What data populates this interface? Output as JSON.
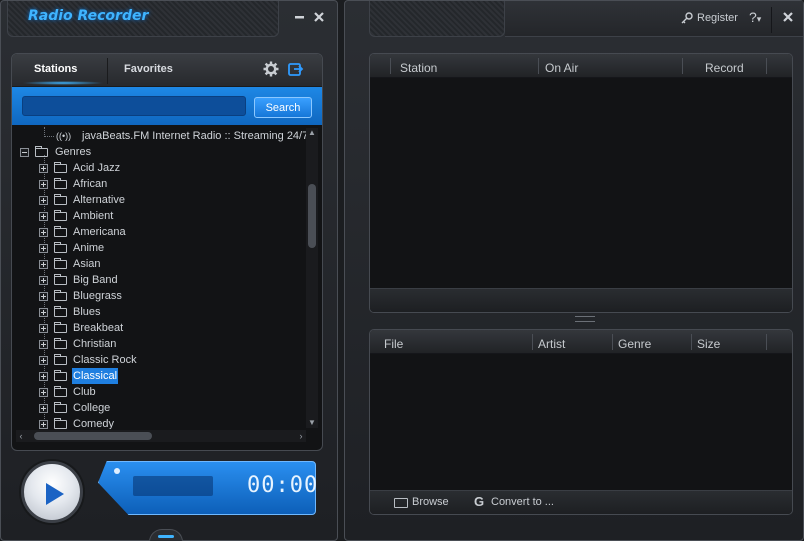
{
  "app": {
    "title": "Radio Recorder"
  },
  "left_window": {
    "minimize_icon": "minimize-icon",
    "close_icon": "close-icon"
  },
  "tabs": [
    {
      "label": "Stations",
      "active": true
    },
    {
      "label": "Favorites",
      "active": false
    }
  ],
  "search": {
    "value": "",
    "placeholder": "",
    "button_label": "Search"
  },
  "tree": {
    "station_item": "javaBeats.FM Internet Radio :: Streaming 24/7",
    "root_label": "Genres",
    "genres": [
      "Acid Jazz",
      "African",
      "Alternative",
      "Ambient",
      "Americana",
      "Anime",
      "Asian",
      "Big Band",
      "Bluegrass",
      "Blues",
      "Breakbeat",
      "Christian",
      "Classic Rock",
      "Classical",
      "Club",
      "College",
      "Comedy"
    ],
    "selected": "Classical"
  },
  "player": {
    "time": "00:00",
    "progress": 0
  },
  "right_window": {
    "register_label": "Register",
    "help_label": "?",
    "close_icon": "close-icon"
  },
  "stations_grid": {
    "columns": [
      "Station",
      "On Air",
      "Record"
    ]
  },
  "files_grid": {
    "columns": [
      "File",
      "Artist",
      "Genre",
      "Size"
    ],
    "browse_label": "Browse",
    "convert_label": "Convert to ..."
  },
  "colors": {
    "accent": "#1f7fe0",
    "title": "#3fb4ff",
    "background": "#1b1d20",
    "panel": "#121315"
  }
}
